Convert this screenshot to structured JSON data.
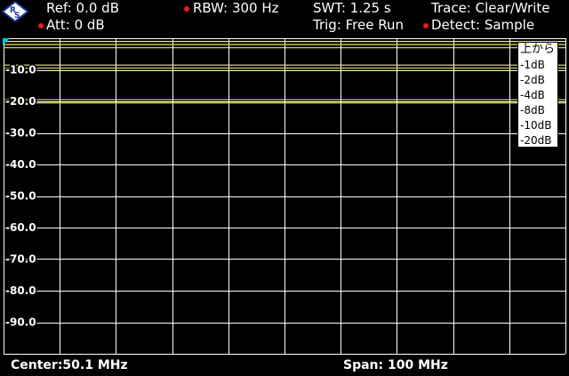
{
  "header": {
    "ref": "Ref:  0.0 dB",
    "att": "Att:  0 dB",
    "rbw": "RBW:   300 Hz",
    "swt": "SWT:   1.25 s",
    "trig": "Trig:   Free Run",
    "trace": "Trace:   Clear/Write",
    "detect": "Detect:  Sample"
  },
  "chart_data": {
    "type": "line",
    "ylim": [
      -100,
      0
    ],
    "y_ticks": [
      -10.0,
      -20.0,
      -30.0,
      -40.0,
      -50.0,
      -60.0,
      -70.0,
      -80.0,
      -90.0
    ],
    "y_tick_labels": [
      "-10.0",
      "-20.0",
      "-30.0",
      "-40.0",
      "-50.0",
      "-60.0",
      "-70.0",
      "-80.0",
      "-90.0"
    ],
    "grid": true,
    "x_divisions": 10,
    "trace_color": "#e8e870",
    "series": [
      {
        "name": "上から",
        "values_db": [
          -1,
          -1
        ]
      },
      {
        "name": "-1dB",
        "values_db": [
          -2,
          -2
        ]
      },
      {
        "name": "-2dB",
        "values_db": [
          -3,
          -3
        ]
      },
      {
        "name": "-4dB",
        "values_db": [
          -8.5,
          -8.5
        ]
      },
      {
        "name": "-8dB",
        "values_db": [
          -9.5,
          -9.5
        ]
      },
      {
        "name": "-10dB",
        "values_db": [
          -19.5,
          -19.5
        ]
      },
      {
        "name": "-20dB",
        "values_db": [
          -20.5,
          -20.5
        ]
      }
    ]
  },
  "legend": {
    "title": "上から",
    "items": [
      "-1dB",
      "-2dB",
      "-4dB",
      "-8dB",
      "-10dB",
      "-20dB"
    ]
  },
  "footer": {
    "center": "Center:50.1 MHz",
    "span": "Span:    100 MHz"
  },
  "colors": {
    "grid": "#ffffff",
    "trace": "#e8e870",
    "background": "#000000",
    "indicator_dot": "#e02020",
    "marker_cyan": "#00c8d8"
  }
}
